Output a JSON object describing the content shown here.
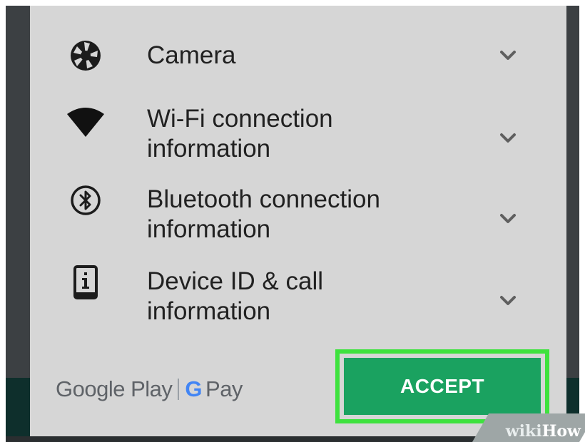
{
  "permissions": [
    {
      "label_line1": "Camera",
      "label_line2": "",
      "icon": "camera-aperture-icon"
    },
    {
      "label_line1": "Wi-Fi connection",
      "label_line2": "information",
      "icon": "wifi-icon"
    },
    {
      "label_line1": "Bluetooth connection",
      "label_line2": "information",
      "icon": "bluetooth-icon"
    },
    {
      "label_line1": "Device ID & call",
      "label_line2": "information",
      "icon": "device-info-icon"
    }
  ],
  "footer": {
    "brand_left": "Google Play",
    "brand_right_g": "G",
    "brand_right": "Pay"
  },
  "accept_label": "ACCEPT",
  "watermark": {
    "part1": "wiki",
    "part2": "How"
  },
  "colors": {
    "accept": "#1aa260",
    "highlight": "#3ee23e",
    "dialog_bg": "#d6d6d6"
  }
}
